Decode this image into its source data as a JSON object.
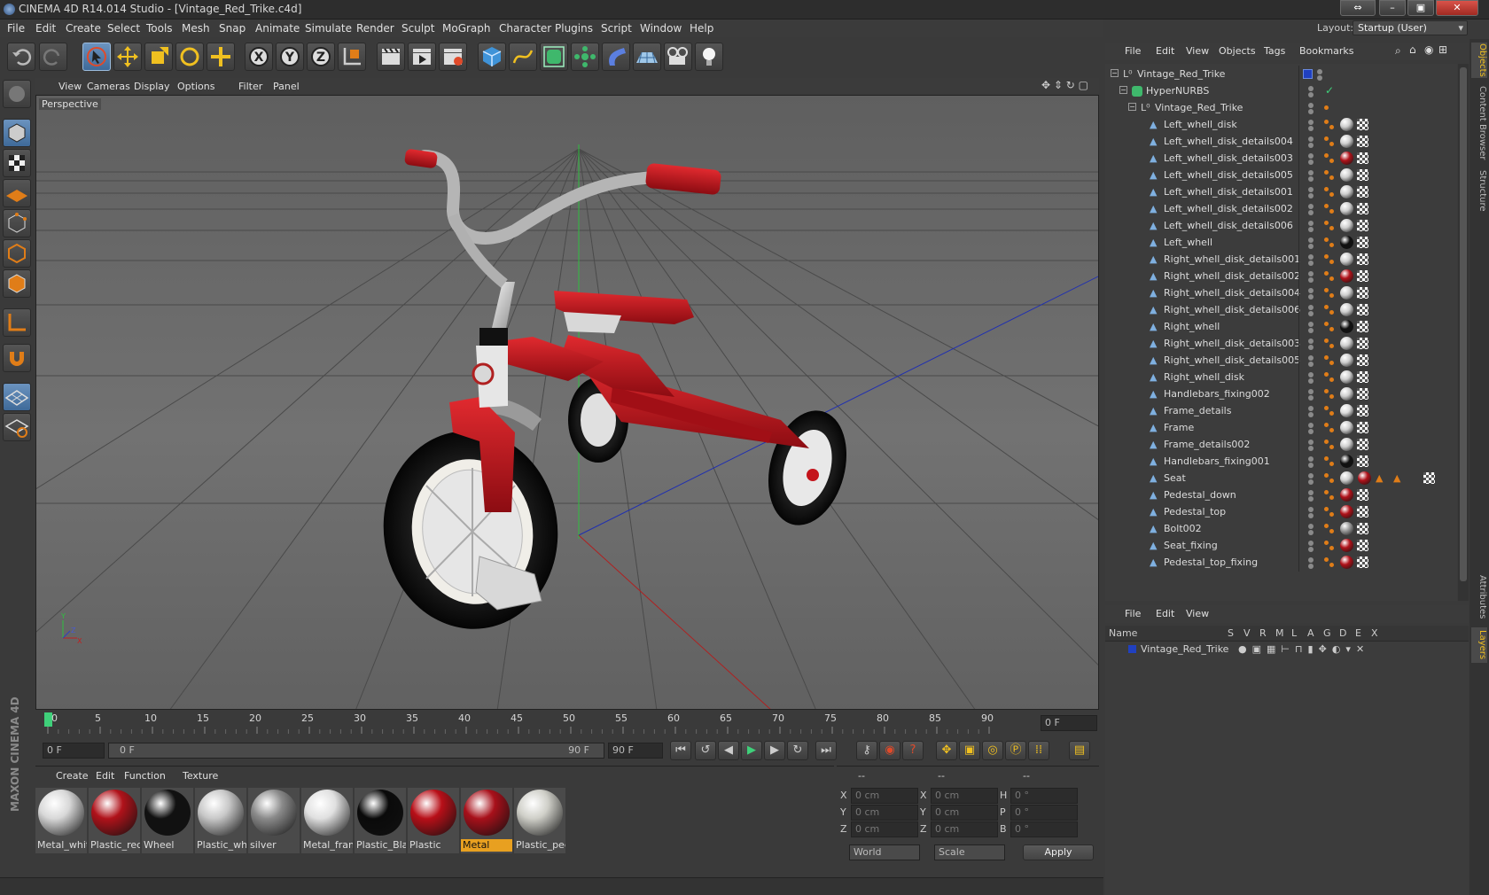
{
  "window": {
    "title": "CINEMA 4D R14.014 Studio - [Vintage_Red_Trike.c4d]"
  },
  "menu": [
    "File",
    "Edit",
    "Create",
    "Select",
    "Tools",
    "Mesh",
    "Snap",
    "Animate",
    "Simulate",
    "Render",
    "Sculpt",
    "MoGraph",
    "Character",
    "Plugins",
    "Script",
    "Window",
    "Help"
  ],
  "layout": {
    "label": "Layout:",
    "value": "Startup (User)"
  },
  "viewport": {
    "menu": [
      "View",
      "Cameras",
      "Display",
      "Options",
      "Filter",
      "Panel"
    ],
    "label": "Perspective",
    "axis": {
      "y": "Y",
      "z": "Z",
      "x": "X"
    }
  },
  "timeline": {
    "ticks": [
      "0",
      "5",
      "10",
      "15",
      "20",
      "25",
      "30",
      "35",
      "40",
      "45",
      "50",
      "55",
      "60",
      "65",
      "70",
      "75",
      "80",
      "85",
      "90"
    ],
    "frame_field": "0 F"
  },
  "transport": {
    "start": "0 F",
    "range_start": "0 F",
    "range_end": "90 F",
    "end": "90 F"
  },
  "materials": {
    "menu": [
      "Create",
      "Edit",
      "Function",
      "Texture"
    ],
    "items": [
      {
        "name": "Metal_whit",
        "color": "#d8d8d8"
      },
      {
        "name": "Plastic_red",
        "color": "#b0121a"
      },
      {
        "name": "Wheel",
        "color": "#111111"
      },
      {
        "name": "Plastic_whi",
        "color": "#c8c8c8"
      },
      {
        "name": "silver",
        "color": "#8a8a8a"
      },
      {
        "name": "Metal_fram",
        "color": "#e0e0e0"
      },
      {
        "name": "Plastic_Blac",
        "color": "#0a0a0a"
      },
      {
        "name": "Plastic",
        "color": "#b80f18"
      },
      {
        "name": "Metal",
        "color": "#a8101a",
        "selected": true
      },
      {
        "name": "Plastic_ped",
        "color": "#cfcfc8"
      }
    ]
  },
  "coords": {
    "header": [
      "--",
      "--",
      "--"
    ],
    "rows": [
      {
        "a": "X",
        "av": "0 cm",
        "b": "X",
        "bv": "0 cm",
        "c": "H",
        "cv": "0 °"
      },
      {
        "a": "Y",
        "av": "0 cm",
        "b": "Y",
        "bv": "0 cm",
        "c": "P",
        "cv": "0 °"
      },
      {
        "a": "Z",
        "av": "0 cm",
        "b": "Z",
        "bv": "0 cm",
        "c": "B",
        "cv": "0 °"
      }
    ],
    "world": "World",
    "scale": "Scale",
    "apply": "Apply"
  },
  "objects": {
    "menu": [
      "File",
      "Edit",
      "View",
      "Objects",
      "Tags",
      "Bookmarks"
    ],
    "root": "Vintage_Red_Trike",
    "nurbs": "HyperNURBS",
    "group": "Vintage_Red_Trike",
    "items": [
      {
        "name": "Left_whell_disk",
        "mat": "#cfcfcf"
      },
      {
        "name": "Left_whell_disk_details004",
        "mat": "#cfcfcf"
      },
      {
        "name": "Left_whell_disk_details003",
        "mat": "#b0121a"
      },
      {
        "name": "Left_whell_disk_details005",
        "mat": "#cfcfcf"
      },
      {
        "name": "Left_whell_disk_details001",
        "mat": "#cfcfcf"
      },
      {
        "name": "Left_whell_disk_details002",
        "mat": "#cfcfcf"
      },
      {
        "name": "Left_whell_disk_details006",
        "mat": "#cfcfcf"
      },
      {
        "name": "Left_whell",
        "mat": "#111111"
      },
      {
        "name": "Right_whell_disk_details001",
        "mat": "#cfcfcf"
      },
      {
        "name": "Right_whell_disk_details002",
        "mat": "#b0121a"
      },
      {
        "name": "Right_whell_disk_details004",
        "mat": "#cfcfcf"
      },
      {
        "name": "Right_whell_disk_details006",
        "mat": "#cfcfcf"
      },
      {
        "name": "Right_whell",
        "mat": "#111111"
      },
      {
        "name": "Right_whell_disk_details003",
        "mat": "#cfcfcf"
      },
      {
        "name": "Right_whell_disk_details005",
        "mat": "#cfcfcf"
      },
      {
        "name": "Right_whell_disk",
        "mat": "#cfcfcf"
      },
      {
        "name": "Handlebars_fixing002",
        "mat": "#cfcfcf"
      },
      {
        "name": "Frame_details",
        "mat": "#dcdcdc"
      },
      {
        "name": "Frame",
        "mat": "#cfcfcf"
      },
      {
        "name": "Frame_details002",
        "mat": "#cfcfcf"
      },
      {
        "name": "Handlebars_fixing001",
        "mat": "#111111"
      },
      {
        "name": "Seat",
        "mat": "#cfcfcf"
      },
      {
        "name": "Pedestal_down",
        "mat": "#b0121a"
      },
      {
        "name": "Pedestal_top",
        "mat": "#b0121a"
      },
      {
        "name": "Bolt002",
        "mat": "#9a9a9a"
      },
      {
        "name": "Seat_fixing",
        "mat": "#b0121a"
      },
      {
        "name": "Pedestal_top_fixing",
        "mat": "#b0121a"
      }
    ]
  },
  "layers": {
    "menu": [
      "File",
      "Edit",
      "View"
    ],
    "columns": [
      "Name",
      "S",
      "V",
      "R",
      "M",
      "L",
      "A",
      "G",
      "D",
      "E",
      "X"
    ],
    "row": "Vintage_Red_Trike"
  },
  "side_tabs": [
    "Objects",
    "Content Browser",
    "Structure",
    "Attributes",
    "Layers"
  ],
  "brand": "MAXON CINEMA 4D",
  "colors": {
    "accent": "#3f6a99",
    "tag_orange": "#e07d18",
    "selected_mat": "#e8a020"
  }
}
